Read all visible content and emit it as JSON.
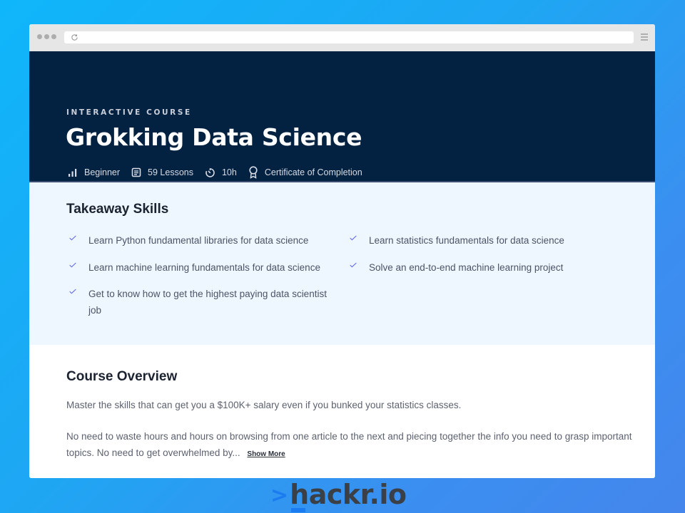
{
  "browser": {
    "url": "",
    "reload_icon": "reload-icon",
    "menu_icon": "hamburger-menu-icon"
  },
  "hero": {
    "eyebrow": "INTERACTIVE COURSE",
    "title": "Grokking Data Science",
    "meta": [
      {
        "icon": "signal-bars-icon",
        "label": "Beginner"
      },
      {
        "icon": "lessons-icon",
        "label": "59 Lessons"
      },
      {
        "icon": "timer-icon",
        "label": "10h"
      },
      {
        "icon": "certificate-icon",
        "label": "Certificate of Completion"
      }
    ]
  },
  "skills": {
    "heading": "Takeaway Skills",
    "items": [
      "Learn Python fundamental libraries for data science",
      "Learn statistics fundamentals for data science",
      "Learn machine learning fundamentals for data science",
      "Solve an end-to-end machine learning project",
      "Get to know how to get the highest paying data scientist job"
    ]
  },
  "overview": {
    "heading": "Course Overview",
    "paragraphs": [
      "Master the skills that can get you a $100K+ salary even if you bunked your statistics classes.",
      "No need to waste hours and hours on browsing from one article to the next and piecing together the info you need to grasp important topics. No need to get overwhelmed by..."
    ],
    "show_more": "Show More"
  },
  "brand": {
    "chevron": ">",
    "name": "hackr.io"
  },
  "colors": {
    "hero_bg": "#032140",
    "skills_bg": "#eef6ff",
    "check": "#5b63e8",
    "brand_blue": "#1a7cf0"
  }
}
